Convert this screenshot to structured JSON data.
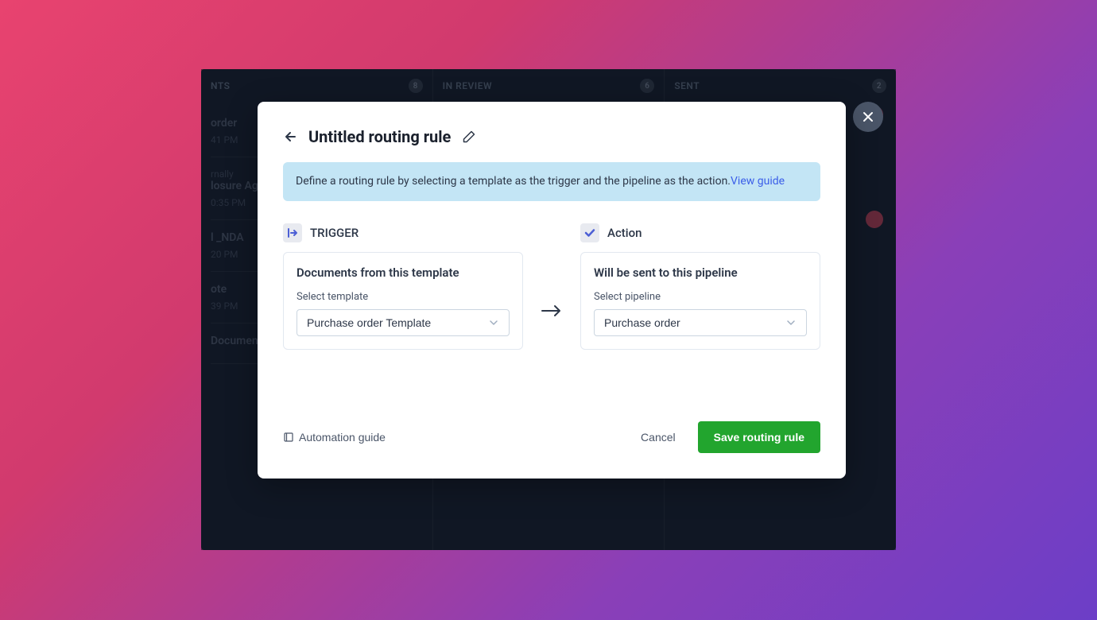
{
  "background": {
    "columns": [
      {
        "header": "NTS",
        "count": "8",
        "cards": [
          {
            "title": "order",
            "meta": "41 PM"
          },
          {
            "title": "losure Agr",
            "meta": "0:35 PM",
            "prefix": "rnally"
          },
          {
            "title": "l _NDA",
            "meta": "20 PM"
          },
          {
            "title": "ote",
            "meta": "39 PM"
          },
          {
            "title": "Document",
            "meta": ""
          }
        ]
      },
      {
        "header": "IN REVIEW",
        "count": "6",
        "cards": []
      },
      {
        "header": "SENT",
        "count": "2",
        "cards": []
      }
    ]
  },
  "modal": {
    "title": "Untitled routing rule",
    "banner_text": "Define a routing rule by selecting a template as the trigger and the pipeline as the action.",
    "banner_link": "View guide",
    "trigger": {
      "label": "TRIGGER",
      "card_title": "Documents from this template",
      "field_label": "Select template",
      "value": "Purchase order Template"
    },
    "action": {
      "label": "Action",
      "card_title": "Will be sent to this pipeline",
      "field_label": "Select pipeline",
      "value": "Purchase order"
    },
    "footer": {
      "guide": "Automation guide",
      "cancel": "Cancel",
      "save": "Save routing rule"
    }
  }
}
